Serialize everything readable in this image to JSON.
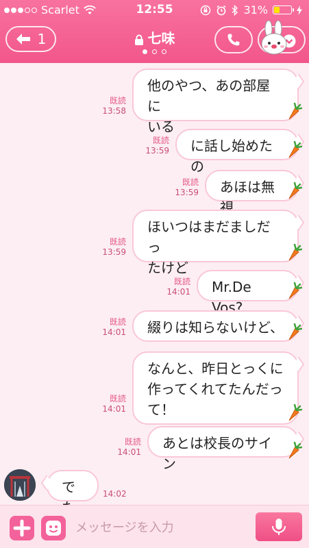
{
  "status_bar": {
    "carrier": "Scarlet",
    "time": "12:55",
    "battery": "31%"
  },
  "header": {
    "back_count": "1",
    "title": "七味"
  },
  "messages": [
    {
      "text": "他のやつ、あの部屋に\nいる",
      "read": "既読",
      "time": "13:58"
    },
    {
      "text": "に話し始めたの",
      "read": "既読",
      "time": "13:59"
    },
    {
      "text": "あほは無視",
      "read": "既読",
      "time": "13:59"
    },
    {
      "text": "ほいつはまだましだっ\nたけど",
      "read": "既読",
      "time": "13:59"
    },
    {
      "text": "Mr.De Vos?",
      "read": "既読",
      "time": "14:01"
    },
    {
      "text": "綴りは知らないけど、",
      "read": "既読",
      "time": "14:01"
    },
    {
      "text": "なんと、昨日とっくに\n作ってくれてたんだっ\nて！",
      "read": "既読",
      "time": "14:01"
    },
    {
      "text": "あとは校長のサイン",
      "read": "既読",
      "time": "14:01"
    }
  ],
  "incoming": {
    "text": "でた",
    "time": "14:02"
  },
  "input": {
    "placeholder": "メッセージを入力"
  },
  "colors": {
    "header": "#f2568a",
    "bubble_border": "#f9c7d8",
    "background": "#fdeef3",
    "read_label": "#e45a8a"
  }
}
